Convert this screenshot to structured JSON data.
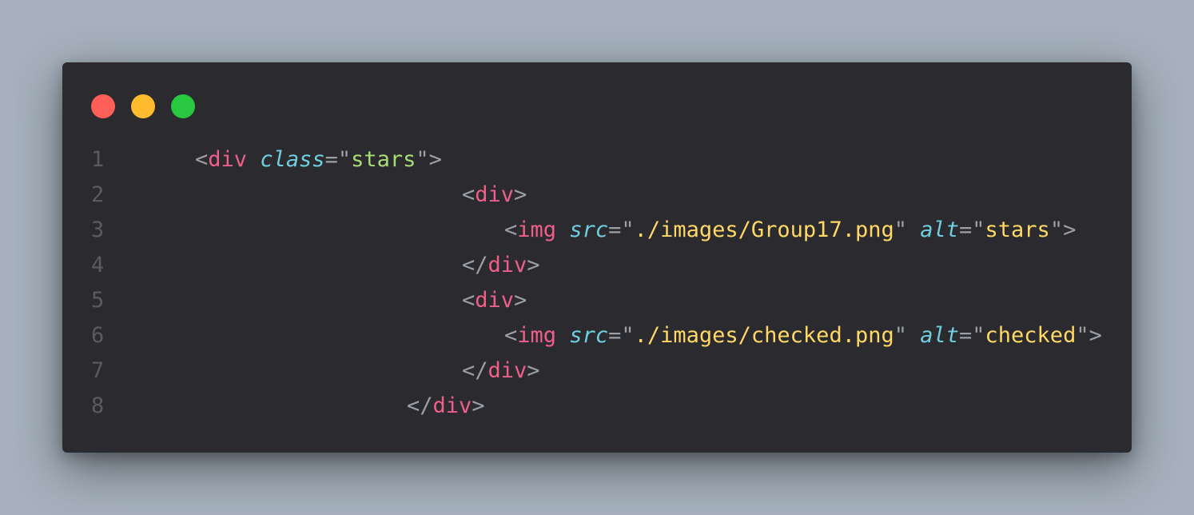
{
  "window": {
    "buttons": [
      {
        "name": "close",
        "color": "#ff5f57"
      },
      {
        "name": "minimize",
        "color": "#febc2e"
      },
      {
        "name": "maximize",
        "color": "#28c840"
      }
    ]
  },
  "colors": {
    "background": "#a6b1bd",
    "editor": "#2b2a2f",
    "line_number": "#5b5a60",
    "punctuation": "#9aa0a6",
    "tag": "#ee5f8a",
    "attribute": "#6fcfe0",
    "string": "#ffd866",
    "string_alt": "#a8dc76"
  },
  "code": {
    "lines": [
      {
        "number": "1",
        "tokens": [
          {
            "text": "<",
            "kind": "punc"
          },
          {
            "text": "div",
            "kind": "tag"
          },
          {
            "text": " ",
            "kind": "punc"
          },
          {
            "text": "class",
            "kind": "attr"
          },
          {
            "text": "=\"",
            "kind": "punc"
          },
          {
            "text": "stars",
            "kind": "str-green"
          },
          {
            "text": "\">",
            "kind": "punc"
          }
        ]
      },
      {
        "number": "2",
        "tokens": [
          {
            "text": "<",
            "kind": "punc"
          },
          {
            "text": "div",
            "kind": "tag"
          },
          {
            "text": ">",
            "kind": "punc"
          }
        ]
      },
      {
        "number": "3",
        "tokens": [
          {
            "text": "<",
            "kind": "punc"
          },
          {
            "text": "img",
            "kind": "tag"
          },
          {
            "text": " ",
            "kind": "punc"
          },
          {
            "text": "src",
            "kind": "attr"
          },
          {
            "text": "=\"",
            "kind": "punc"
          },
          {
            "text": "./images/Group17.png",
            "kind": "str"
          },
          {
            "text": "\" ",
            "kind": "punc"
          },
          {
            "text": "alt",
            "kind": "attr"
          },
          {
            "text": "=\"",
            "kind": "punc"
          },
          {
            "text": "stars",
            "kind": "str"
          },
          {
            "text": "\">",
            "kind": "punc"
          }
        ]
      },
      {
        "number": "4",
        "tokens": [
          {
            "text": "</",
            "kind": "punc"
          },
          {
            "text": "div",
            "kind": "tag"
          },
          {
            "text": ">",
            "kind": "punc"
          }
        ]
      },
      {
        "number": "5",
        "tokens": [
          {
            "text": "<",
            "kind": "punc"
          },
          {
            "text": "div",
            "kind": "tag"
          },
          {
            "text": ">",
            "kind": "punc"
          }
        ]
      },
      {
        "number": "6",
        "tokens": [
          {
            "text": "<",
            "kind": "punc"
          },
          {
            "text": "img",
            "kind": "tag"
          },
          {
            "text": " ",
            "kind": "punc"
          },
          {
            "text": "src",
            "kind": "attr"
          },
          {
            "text": "=\"",
            "kind": "punc"
          },
          {
            "text": "./images/checked.png",
            "kind": "str"
          },
          {
            "text": "\" ",
            "kind": "punc"
          },
          {
            "text": "alt",
            "kind": "attr"
          },
          {
            "text": "=\"",
            "kind": "punc"
          },
          {
            "text": "checked",
            "kind": "str"
          },
          {
            "text": "\">",
            "kind": "punc"
          }
        ]
      },
      {
        "number": "7",
        "tokens": [
          {
            "text": "</",
            "kind": "punc"
          },
          {
            "text": "div",
            "kind": "tag"
          },
          {
            "text": ">",
            "kind": "punc"
          }
        ]
      },
      {
        "number": "8",
        "tokens": [
          {
            "text": "</",
            "kind": "punc"
          },
          {
            "text": "div",
            "kind": "tag"
          },
          {
            "text": ">",
            "kind": "punc"
          }
        ]
      }
    ]
  }
}
